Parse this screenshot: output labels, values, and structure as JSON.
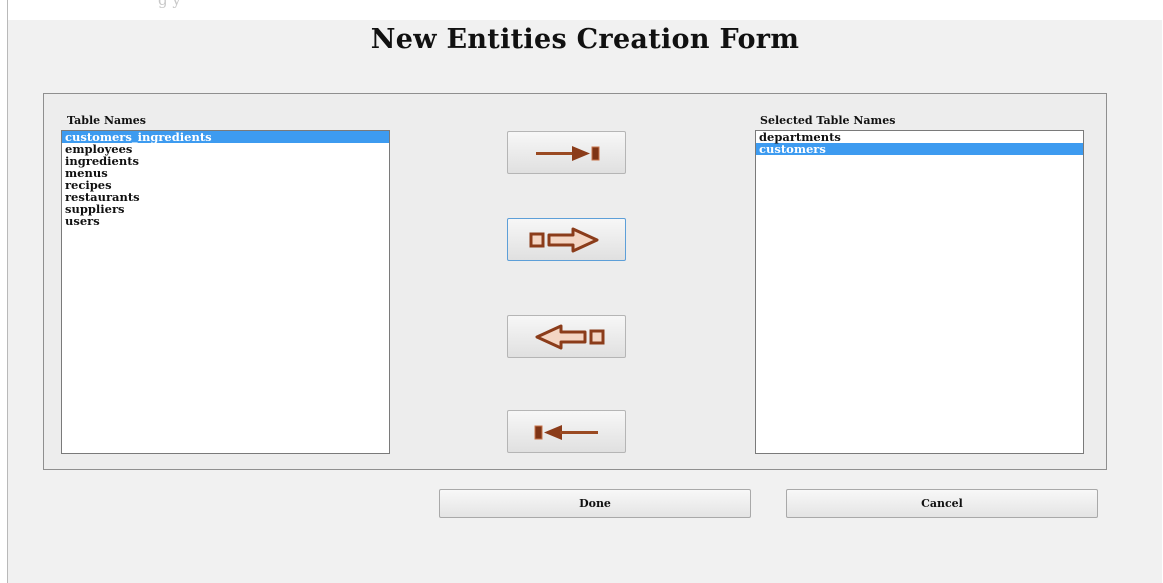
{
  "caption": {
    "text": "g                  y"
  },
  "form": {
    "title": "New Entities Creation Form"
  },
  "available": {
    "label": "Table Names",
    "items": [
      {
        "label": "customers_ingredients",
        "selected": true
      },
      {
        "label": "employees",
        "selected": false
      },
      {
        "label": "ingredients",
        "selected": false
      },
      {
        "label": "menus",
        "selected": false
      },
      {
        "label": "recipes",
        "selected": false
      },
      {
        "label": "restaurants",
        "selected": false
      },
      {
        "label": "suppliers",
        "selected": false
      },
      {
        "label": "users",
        "selected": false
      }
    ]
  },
  "selected": {
    "label": "Selected Table Names",
    "items": [
      {
        "label": "departments",
        "selected": false
      },
      {
        "label": "customers",
        "selected": true
      }
    ]
  },
  "transfer_buttons": [
    {
      "name": "add-all-button",
      "icon": "arrow-right-to-bar-icon"
    },
    {
      "name": "add-selected-button",
      "icon": "hollow-arrow-right-icon"
    },
    {
      "name": "remove-selected-button",
      "icon": "hollow-arrow-left-icon"
    },
    {
      "name": "remove-all-button",
      "icon": "arrow-left-from-bar-icon"
    }
  ],
  "actions": {
    "done_label": "Done",
    "cancel_label": "Cancel"
  },
  "colors": {
    "selection": "#3d9bf0",
    "icon_fill": "#8b3c1a",
    "icon_fill_light": "#c7734a"
  }
}
